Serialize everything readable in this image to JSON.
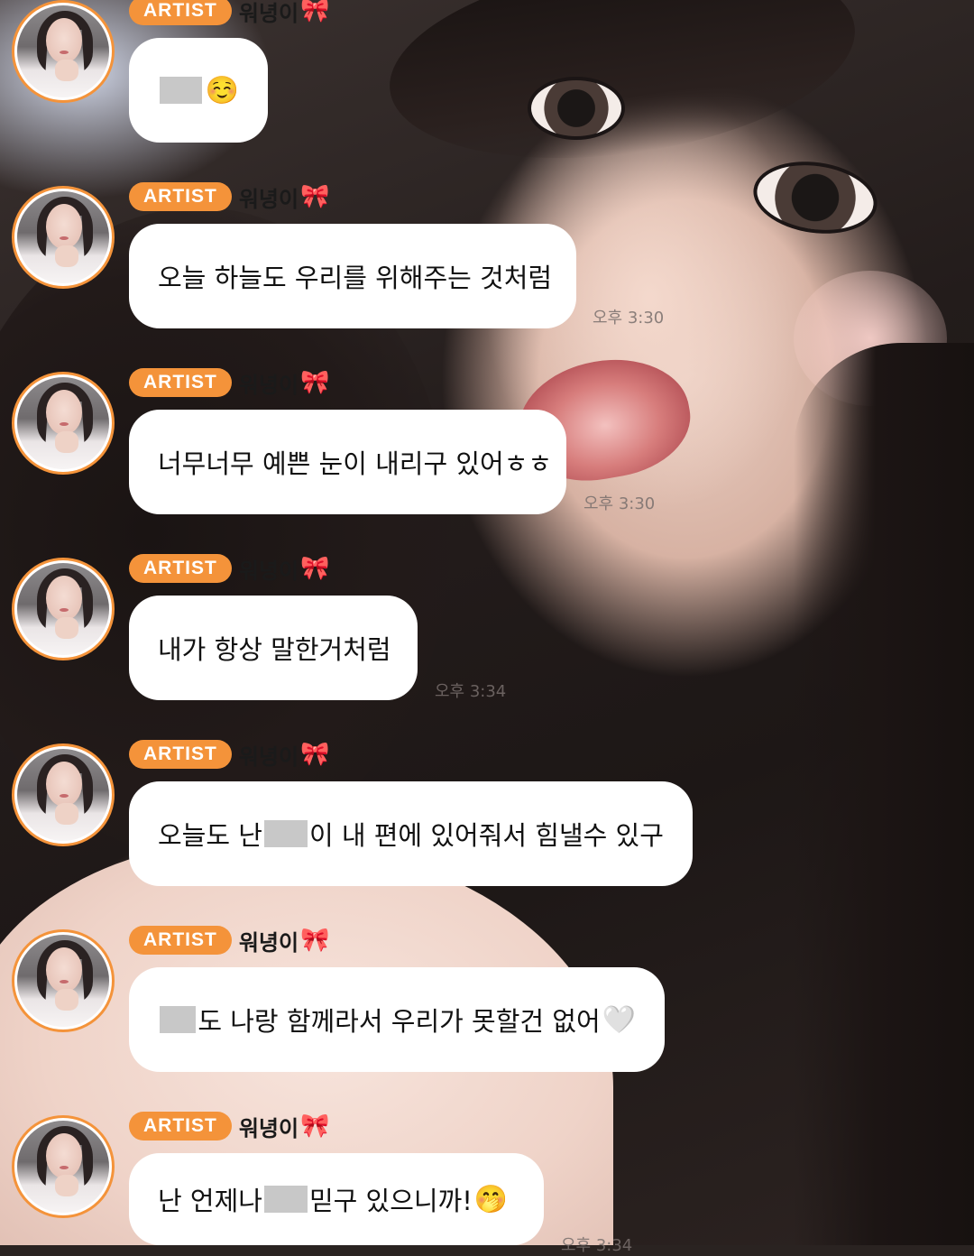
{
  "artist_badge": "ARTIST",
  "sender_name": "워녕이",
  "ribbon_icon": "🎀",
  "messages": [
    {
      "parts": [
        "",
        "☺️"
      ],
      "timestamp": ""
    },
    {
      "parts": [
        "오늘 하늘도 우리를 위해주는 것처럼"
      ],
      "timestamp": "오후 3:30"
    },
    {
      "parts": [
        "너무너무 예쁜 눈이 내리구 있어ㅎㅎ"
      ],
      "timestamp": "오후 3:30"
    },
    {
      "parts": [
        "내가 항상 말한거처럼"
      ],
      "timestamp": "오후 3:34"
    },
    {
      "parts": [
        "오늘도 난 ",
        "이 내 편에 있어줘서 힘낼수 있구"
      ],
      "timestamp": ""
    },
    {
      "parts": [
        "",
        "도 나랑 함께라서 우리가 못할건 없어",
        "🤍"
      ],
      "timestamp": ""
    },
    {
      "parts": [
        "난 언제나 ",
        " 믿구 있으니까!",
        "🤭"
      ],
      "timestamp": "오후 3:34"
    }
  ]
}
